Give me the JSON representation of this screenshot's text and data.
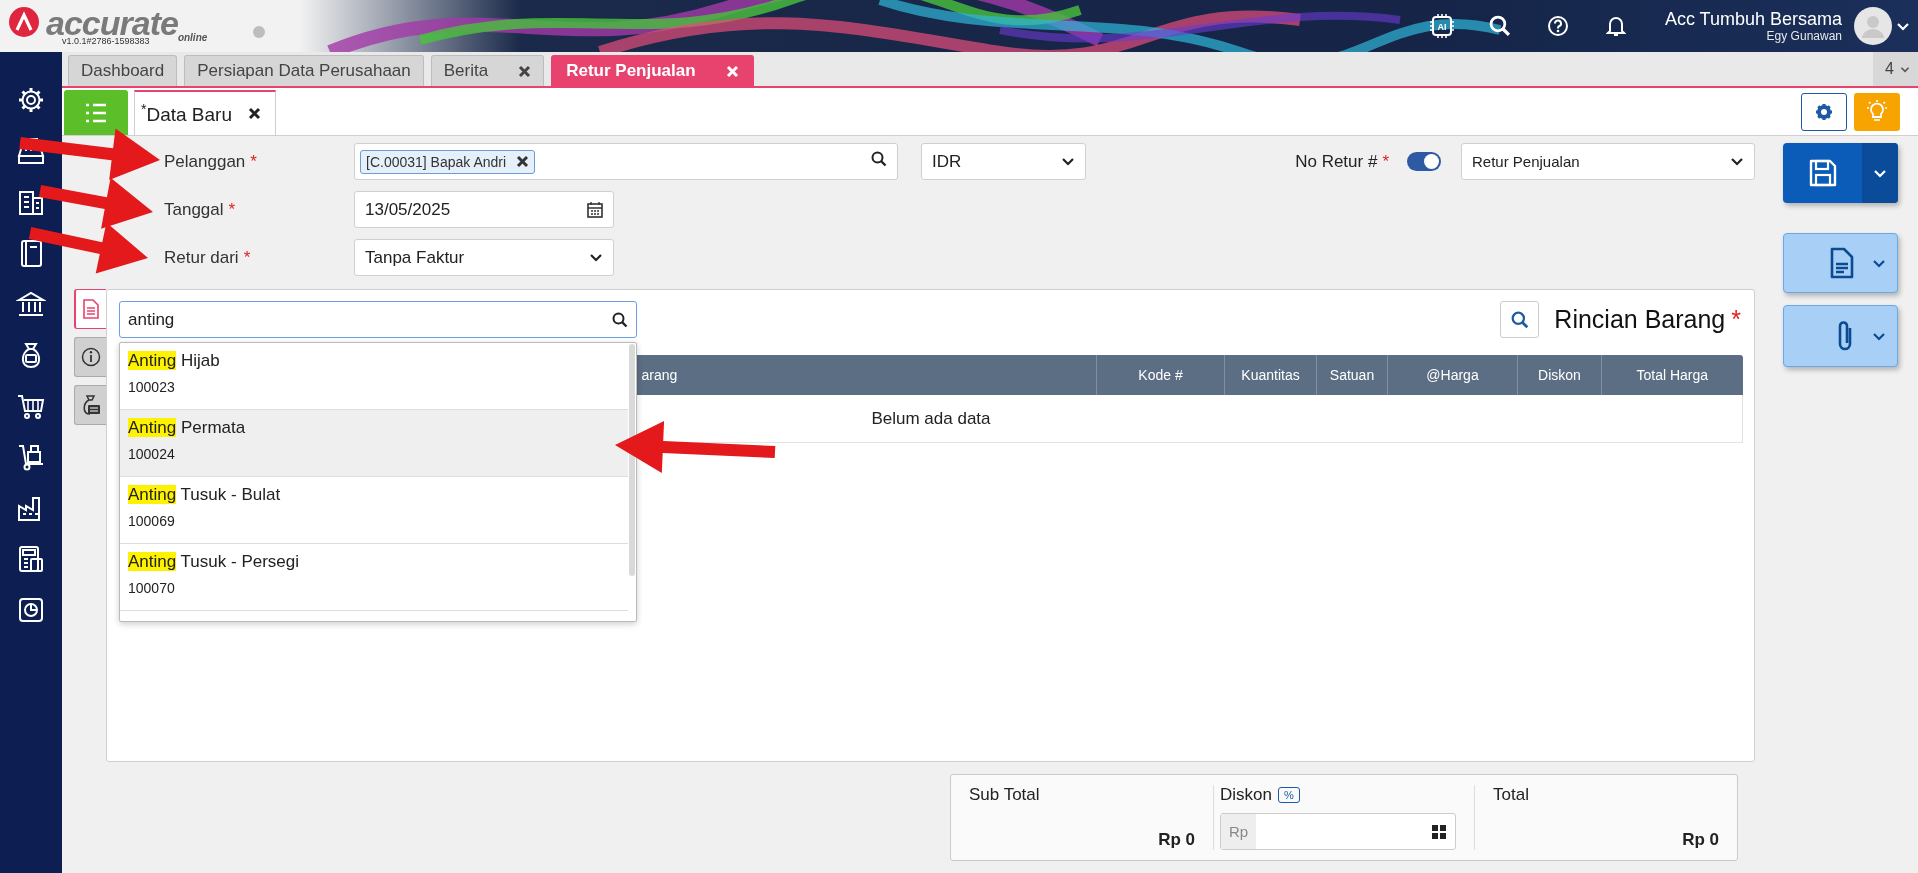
{
  "header": {
    "logo_text": "accurate",
    "logo_sub": "online",
    "version": "v1.0.1#2786-1598383",
    "ai_label": "AI",
    "company": "Acc Tumbuh Bersama",
    "user": "Egy Gunawan"
  },
  "tabs": [
    {
      "label": "Dashboard",
      "selected": false,
      "closable": false
    },
    {
      "label": "Persiapan Data Perusahaan",
      "selected": false,
      "closable": false
    },
    {
      "label": "Berita",
      "selected": false,
      "closable": true
    },
    {
      "label": "Retur Penjualan",
      "selected": true,
      "closable": true
    }
  ],
  "tab_count": "4",
  "subtabs": [
    {
      "label": "Data Baru",
      "modified_mark": "*",
      "selected": true,
      "closable": true
    }
  ],
  "form": {
    "rows": [
      {
        "label": "Pelanggan",
        "required_mark": "*",
        "kind": "chip-search",
        "value": "[C.00031] Bapak Andri"
      },
      {
        "label": "Tanggal",
        "required_mark": "*",
        "kind": "date",
        "value": "13/05/2025"
      },
      {
        "label": "Retur dari",
        "required_mark": "*",
        "kind": "select",
        "value": "Tanpa Faktur"
      }
    ],
    "currency": "IDR",
    "no_retur": {
      "label": "No Retur #",
      "required_mark": "*",
      "auto_number": true,
      "value": "Retur Penjualan"
    }
  },
  "panel": {
    "side_tabs": [
      {
        "kind": "document",
        "selected": true
      },
      {
        "kind": "info",
        "selected": false
      },
      {
        "kind": "money",
        "selected": false
      }
    ],
    "search_value": "anting",
    "title": "Rincian Barang",
    "required_mark": "*",
    "columns": [
      "arang",
      "Kode #",
      "Kuantitas",
      "Satuan",
      "@Harga",
      "Diskon",
      "Total Harga"
    ],
    "empty_text": "Belum ada data",
    "suggestions": [
      {
        "match": "Anting",
        "rest": " Hijab",
        "code": "100023",
        "selected": false
      },
      {
        "match": "Anting",
        "rest": " Permata",
        "code": "100024",
        "selected": true
      },
      {
        "match": "Anting",
        "rest": " Tusuk - Bulat",
        "code": "100069",
        "selected": false
      },
      {
        "match": "Anting",
        "rest": " Tusuk - Persegi",
        "code": "100070",
        "selected": false
      }
    ]
  },
  "totals": {
    "subtotal_label": "Sub Total",
    "subtotal": "Rp 0",
    "discount_label": "Diskon",
    "discount_mode": "%",
    "discount_prefix": "Rp",
    "total_label": "Total",
    "total": "Rp 0"
  },
  "annotations": [
    {
      "kind": "arrow"
    },
    {
      "kind": "arrow"
    },
    {
      "kind": "arrow"
    },
    {
      "kind": "arrow"
    }
  ]
}
